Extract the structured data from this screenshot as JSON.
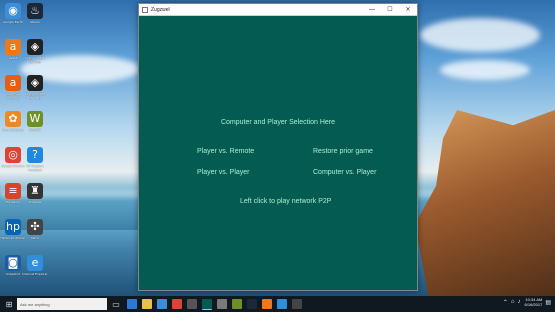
{
  "window": {
    "title": "Zugzwel",
    "minimize_glyph": "—",
    "maximize_glyph": "☐",
    "close_glyph": "✕"
  },
  "menu": {
    "heading": "Computer and Player Selection Here",
    "player_vs_remote": "Player vs. Remote",
    "restore_prior_game": "Restore prior game",
    "player_vs_player": "Player vs. Player",
    "computer_vs_player": "Computer vs. Player",
    "network_p2p": "Left click to play network P2P"
  },
  "desktop_icons": [
    {
      "label": "Google Earth",
      "icon": "globe-icon",
      "color": "#3a8fd6",
      "glyph": "◉"
    },
    {
      "label": "Steam",
      "icon": "steam-icon",
      "color": "#1b2838",
      "glyph": "♨"
    },
    {
      "label": "Avast",
      "icon": "avast-icon",
      "color": "#f07818",
      "glyph": "a"
    },
    {
      "label": "Unity 5.5.1f1 (64-bit)",
      "icon": "unity-icon",
      "color": "#222222",
      "glyph": "◈"
    },
    {
      "label": "Avast Free Antivirus",
      "icon": "avast-antivirus-icon",
      "color": "#e85d10",
      "glyph": "a"
    },
    {
      "label": "Unity 5.6.0f3 (64-bit)",
      "icon": "unity-icon",
      "color": "#222222",
      "glyph": "◈"
    },
    {
      "label": "Avast Cleanup",
      "icon": "avast-cleanup-icon",
      "color": "#f08a20",
      "glyph": "✿"
    },
    {
      "label": "WinRAR",
      "icon": "winrar-icon",
      "color": "#6f8f2a",
      "glyph": "W"
    },
    {
      "label": "Google Chrome",
      "icon": "chrome-icon",
      "color": "#db4437",
      "glyph": "◎"
    },
    {
      "label": "HP Support Assistant",
      "icon": "help-icon",
      "color": "#1e88e5",
      "glyph": "?"
    },
    {
      "label": "Equalizer",
      "icon": "equalizer-icon",
      "color": "#d8442b",
      "glyph": "≡"
    },
    {
      "label": "Zugzwel",
      "icon": "app-icon",
      "color": "#333333",
      "glyph": "♜"
    },
    {
      "label": "HP Smart Printer",
      "icon": "hp-icon",
      "color": "#0b63b6",
      "glyph": "hp"
    },
    {
      "label": "Tetris",
      "icon": "chess-icon",
      "color": "#444444",
      "glyph": "✣"
    },
    {
      "label": "Snapshot",
      "icon": "camera-icon",
      "color": "#1a5ea8",
      "glyph": "◙"
    },
    {
      "label": "Internet Explorer",
      "icon": "ie-icon",
      "color": "#2f8fdc",
      "glyph": "e"
    }
  ],
  "taskbar": {
    "search_placeholder": "Ask me anything",
    "start_icon": "windows-icon",
    "time": "10:34 AM",
    "date": "6/16/2017"
  }
}
